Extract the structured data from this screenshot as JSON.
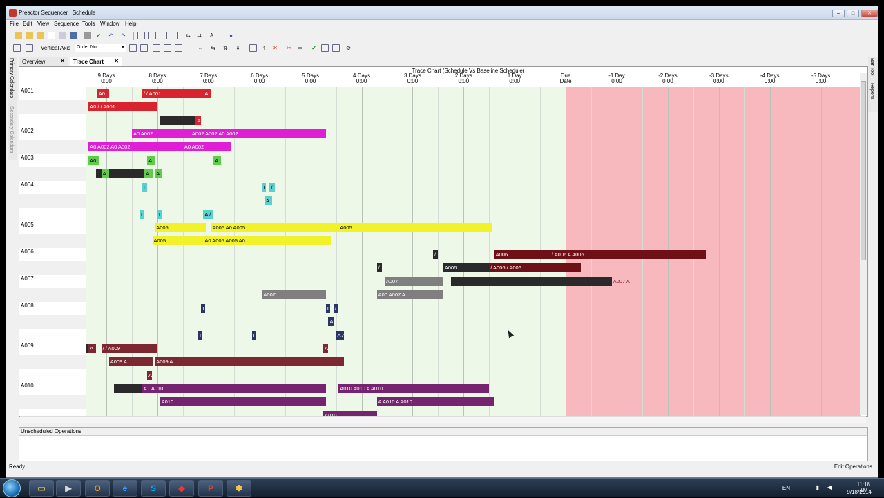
{
  "window": {
    "title": "Preactor Sequencer : Schedule",
    "min": "–",
    "max": "□",
    "close": "✕"
  },
  "menu": [
    "File",
    "Edit",
    "View",
    "Sequence",
    "Tools",
    "Window",
    "Help"
  ],
  "toolbar2": {
    "vertical_axis_label": "Vertical Axis",
    "vertical_axis_value": "Order No."
  },
  "tabs": [
    {
      "label": "Overview",
      "close": "✕"
    },
    {
      "label": "Trace Chart",
      "close": "✕"
    }
  ],
  "left_strip": [
    "Primary Calendars",
    "Secondary Calendars"
  ],
  "right_strip": [
    "Bar Tool",
    "Reports"
  ],
  "chart": {
    "title": "Trace Chart (Schedule Vs Baseline Schedule)",
    "headers": [
      [
        "9 Days",
        "0:00"
      ],
      [
        "8 Days",
        "0:00"
      ],
      [
        "7 Days",
        "0:00"
      ],
      [
        "6 Days",
        "0:00"
      ],
      [
        "5 Days",
        "0:00"
      ],
      [
        "4 Days",
        "0:00"
      ],
      [
        "3 Days",
        "0:00"
      ],
      [
        "2 Days",
        "0:00"
      ],
      [
        "1 Day",
        "0:00"
      ],
      [
        "Due",
        "Date"
      ],
      [
        "-1 Day",
        "0:00"
      ],
      [
        "-2 Days",
        "0:00"
      ],
      [
        "-3 Days",
        "0:00"
      ],
      [
        "-4 Days",
        "0:00"
      ],
      [
        "-5 Days",
        "0:00"
      ]
    ],
    "rows": [
      "A001",
      "A002",
      "A003",
      "A004",
      "A005",
      "A006",
      "A007",
      "A008",
      "A009",
      "A010"
    ],
    "colors": {
      "red": "#d9232e",
      "magenta": "#de1fd6",
      "green": "#5fcc4c",
      "cyan": "#5ad0cf",
      "yellow": "#f2f22b",
      "darkred": "#6e1016",
      "gray": "#7f7f7f",
      "navy": "#2a3566",
      "maroon": "#7c2731",
      "purple": "#76246f",
      "black": "#2a2a2a",
      "late": "#f7b8be",
      "early": "#eef8e8"
    },
    "bars": [
      {
        "row": 0,
        "lane": 0,
        "start": -0.18,
        "end": 0.06,
        "c": "red",
        "t": "A0"
      },
      {
        "row": 0,
        "lane": 0,
        "start": 0.7,
        "end": 1.9,
        "c": "red",
        "t": "/ / A001"
      },
      {
        "row": 0,
        "lane": 0,
        "start": 1.9,
        "end": 2.05,
        "c": "red",
        "t": "A"
      },
      {
        "row": 0,
        "lane": 1,
        "start": -0.35,
        "end": 1.0,
        "c": "red",
        "t": "A0 / / A001"
      },
      {
        "row": 0,
        "lane": 2,
        "start": 1.05,
        "end": 1.75,
        "c": "black",
        "t": ""
      },
      {
        "row": 0,
        "lane": 2,
        "start": 1.75,
        "end": 1.85,
        "c": "red",
        "t": "A"
      },
      {
        "row": 1,
        "lane": 0,
        "start": 0.5,
        "end": 1.65,
        "c": "magenta",
        "t": "A0 A002"
      },
      {
        "row": 1,
        "lane": 0,
        "start": 1.65,
        "end": 4.3,
        "c": "magenta",
        "t": "A002              A002                      A0 A002"
      },
      {
        "row": 1,
        "lane": 1,
        "start": -0.35,
        "end": 1.5,
        "c": "magenta",
        "t": "A0 A002                 A0 A002"
      },
      {
        "row": 1,
        "lane": 1,
        "start": 1.5,
        "end": 2.45,
        "c": "magenta",
        "t": "A0 A002"
      },
      {
        "row": 2,
        "lane": 0,
        "start": -0.35,
        "end": -0.15,
        "c": "green",
        "t": "A0"
      },
      {
        "row": 2,
        "lane": 0,
        "start": 0.8,
        "end": 0.95,
        "c": "green",
        "t": "A"
      },
      {
        "row": 2,
        "lane": 0,
        "start": 2.1,
        "end": 2.25,
        "c": "green",
        "t": "A"
      },
      {
        "row": 2,
        "lane": 1,
        "start": -0.2,
        "end": 0.75,
        "c": "black",
        "t": ""
      },
      {
        "row": 2,
        "lane": 1,
        "start": -0.1,
        "end": 0.05,
        "c": "green",
        "t": "A"
      },
      {
        "row": 2,
        "lane": 1,
        "start": 0.75,
        "end": 0.9,
        "c": "green",
        "t": "A"
      },
      {
        "row": 2,
        "lane": 1,
        "start": 0.95,
        "end": 1.1,
        "c": "green",
        "t": "A"
      },
      {
        "row": 3,
        "lane": 0,
        "start": 0.7,
        "end": 0.8,
        "c": "cyan",
        "t": "I"
      },
      {
        "row": 3,
        "lane": 0,
        "start": 3.05,
        "end": 3.12,
        "c": "cyan",
        "t": "I"
      },
      {
        "row": 3,
        "lane": 0,
        "start": 3.2,
        "end": 3.3,
        "c": "cyan",
        "t": "/"
      },
      {
        "row": 3,
        "lane": 1,
        "start": 3.1,
        "end": 3.25,
        "c": "cyan",
        "t": "A"
      },
      {
        "row": 3,
        "lane": 2,
        "start": 0.65,
        "end": 0.75,
        "c": "cyan",
        "t": "I"
      },
      {
        "row": 3,
        "lane": 2,
        "start": 1.0,
        "end": 1.1,
        "c": "cyan",
        "t": "I"
      },
      {
        "row": 3,
        "lane": 2,
        "start": 1.9,
        "end": 2.1,
        "c": "cyan",
        "t": "A /"
      },
      {
        "row": 4,
        "lane": 0,
        "start": 0.95,
        "end": 1.95,
        "c": "yellow",
        "t": "A005"
      },
      {
        "row": 4,
        "lane": 0,
        "start": 2.05,
        "end": 4.55,
        "c": "yellow",
        "t": "A005              A0 A005"
      },
      {
        "row": 4,
        "lane": 0,
        "start": 4.55,
        "end": 7.55,
        "c": "yellow",
        "t": "A005"
      },
      {
        "row": 4,
        "lane": 1,
        "start": 0.9,
        "end": 1.9,
        "c": "yellow",
        "t": "A005"
      },
      {
        "row": 4,
        "lane": 1,
        "start": 1.9,
        "end": 4.4,
        "c": "yellow",
        "t": "A0 A005                 A005                        A0"
      },
      {
        "row": 5,
        "lane": 0,
        "start": 6.4,
        "end": 6.5,
        "c": "black",
        "t": "/"
      },
      {
        "row": 5,
        "lane": 0,
        "start": 7.6,
        "end": 8.7,
        "c": "darkred",
        "t": "A006"
      },
      {
        "row": 5,
        "lane": 0,
        "start": 8.7,
        "end": 11.75,
        "c": "darkred",
        "t": "/ A006                                                                                     A A006"
      },
      {
        "row": 5,
        "lane": 1,
        "start": 5.3,
        "end": 5.4,
        "c": "black",
        "t": "/"
      },
      {
        "row": 5,
        "lane": 1,
        "start": 6.6,
        "end": 7.5,
        "c": "black",
        "t": "A006"
      },
      {
        "row": 5,
        "lane": 1,
        "start": 7.5,
        "end": 9.3,
        "c": "darkred",
        "t": "/ A006             / A006"
      },
      {
        "row": 6,
        "lane": 0,
        "start": 5.45,
        "end": 6.6,
        "c": "gray",
        "t": "A007"
      },
      {
        "row": 6,
        "lane": 0,
        "start": 6.75,
        "end": 9.9,
        "c": "black",
        "t": ""
      },
      {
        "row": 6,
        "lane": 0,
        "start": 9.9,
        "end": 10.45,
        "c": "late",
        "t": "A007 A"
      },
      {
        "row": 6,
        "lane": 1,
        "start": 3.05,
        "end": 4.3,
        "c": "gray",
        "t": "A007"
      },
      {
        "row": 6,
        "lane": 1,
        "start": 5.3,
        "end": 6.6,
        "c": "gray",
        "t": "A00 A007                     A"
      },
      {
        "row": 7,
        "lane": 0,
        "start": 1.86,
        "end": 1.94,
        "c": "navy",
        "t": "I"
      },
      {
        "row": 7,
        "lane": 0,
        "start": 4.3,
        "end": 4.38,
        "c": "navy",
        "t": "I"
      },
      {
        "row": 7,
        "lane": 0,
        "start": 4.45,
        "end": 4.55,
        "c": "navy",
        "t": "/"
      },
      {
        "row": 7,
        "lane": 1,
        "start": 4.35,
        "end": 4.45,
        "c": "navy",
        "t": "A"
      },
      {
        "row": 7,
        "lane": 2,
        "start": 1.8,
        "end": 1.88,
        "c": "navy",
        "t": "I"
      },
      {
        "row": 7,
        "lane": 2,
        "start": 2.85,
        "end": 2.93,
        "c": "navy",
        "t": "I"
      },
      {
        "row": 7,
        "lane": 2,
        "start": 4.5,
        "end": 4.65,
        "c": "navy",
        "t": "A A"
      },
      {
        "row": 8,
        "lane": 0,
        "start": -0.9,
        "end": -0.35,
        "c": "black",
        "t": ""
      },
      {
        "row": 8,
        "lane": 0,
        "start": -0.35,
        "end": -0.2,
        "c": "maroon",
        "t": "A"
      },
      {
        "row": 8,
        "lane": 0,
        "start": -0.1,
        "end": 1.0,
        "c": "maroon",
        "t": "/ / A009"
      },
      {
        "row": 8,
        "lane": 0,
        "start": 4.25,
        "end": 4.35,
        "c": "maroon",
        "t": "A"
      },
      {
        "row": 8,
        "lane": 1,
        "start": 0.05,
        "end": 0.9,
        "c": "maroon",
        "t": "A009                A"
      },
      {
        "row": 8,
        "lane": 1,
        "start": 0.95,
        "end": 4.65,
        "c": "maroon",
        "t": "A009                                                                                                  A"
      },
      {
        "row": 8,
        "lane": 2,
        "start": 0.8,
        "end": 0.9,
        "c": "maroon",
        "t": "A"
      },
      {
        "row": 9,
        "lane": 0,
        "start": 0.15,
        "end": 0.7,
        "c": "black",
        "t": ""
      },
      {
        "row": 9,
        "lane": 0,
        "start": 0.7,
        "end": 0.85,
        "c": "purple",
        "t": "A"
      },
      {
        "row": 9,
        "lane": 0,
        "start": 0.85,
        "end": 4.3,
        "c": "purple",
        "t": "A010"
      },
      {
        "row": 9,
        "lane": 0,
        "start": 4.55,
        "end": 7.5,
        "c": "purple",
        "t": "A010               A010                      A A010"
      },
      {
        "row": 9,
        "lane": 1,
        "start": 1.05,
        "end": 4.3,
        "c": "purple",
        "t": "A010"
      },
      {
        "row": 9,
        "lane": 1,
        "start": 5.3,
        "end": 7.6,
        "c": "purple",
        "t": "A A010                   A A010"
      },
      {
        "row": 9,
        "lane": 2,
        "start": 4.25,
        "end": 5.3,
        "c": "purple",
        "t": "A010"
      }
    ]
  },
  "unscheduled": {
    "title": "Unscheduled Operations"
  },
  "status": {
    "left": "Ready",
    "right": "Edit Operations"
  },
  "tray": {
    "lang": "EN",
    "time": "11:18 AM",
    "date": "9/18/2014"
  }
}
